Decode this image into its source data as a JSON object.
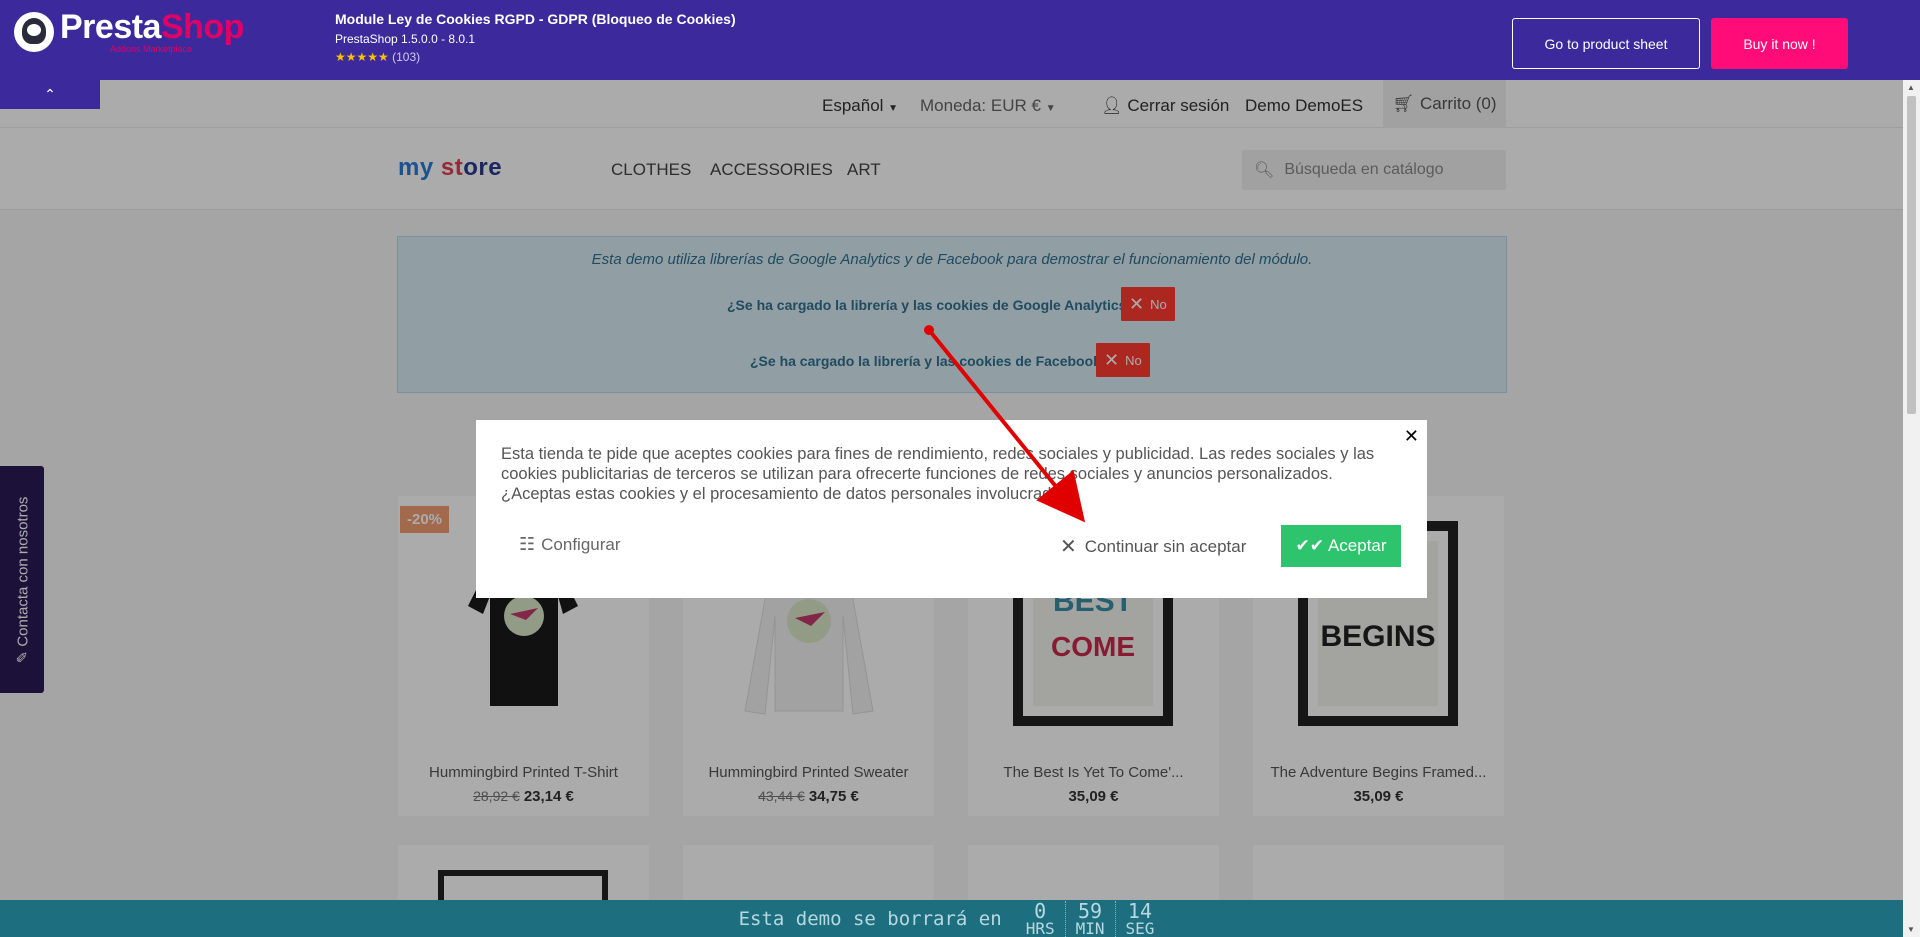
{
  "addons_bar": {
    "logo_text": "PrestaShop",
    "logo_sub": "Addons Marketplace",
    "product_title": "Module Ley de Cookies RGPD - GDPR (Bloqueo de Cookies)",
    "product_version": "PrestaShop 1.5.0.0 - 8.0.1",
    "rating_stars": "★★★★★",
    "rating_count": "(103)",
    "btn_sheet": "Go to product sheet",
    "btn_buy": "Buy it now !",
    "collapse_icon": "⌃"
  },
  "store_nav": {
    "language": "Español",
    "currency": "Moneda: EUR €",
    "logout": "Cerrar sesión",
    "user": "Demo DemoES",
    "cart": "Carrito (0)"
  },
  "store": {
    "logo": [
      "my",
      " st",
      "ore"
    ],
    "menu": [
      "CLOTHES",
      "ACCESSORIES",
      "ART"
    ],
    "search_placeholder": "Búsqueda en catálogo"
  },
  "demo_info": {
    "line1": "Esta demo utiliza librerías de Google Analytics y de Facebook para demostrar el funcionamiento del módulo.",
    "q_google": "¿Se ha cargado la librería y las cookies de Google Analytics?",
    "q_facebook": "¿Se ha cargado la librería y las cookies de Facebook?",
    "no_label": "No"
  },
  "products": [
    {
      "name": "Hummingbird Printed T-Shirt",
      "old_price": "28,92 €",
      "price": "23,14 €",
      "discount": "-20%"
    },
    {
      "name": "Hummingbird Printed Sweater",
      "old_price": "43,44 €",
      "price": "34,75 €"
    },
    {
      "name": "The Best Is Yet To Come'...",
      "price": "35,09 €"
    },
    {
      "name": "The Adventure Begins Framed...",
      "price": "35,09 €"
    }
  ],
  "contact_tab": "Contacta con nosotros",
  "cookie_modal": {
    "text": "Esta tienda te pide que aceptes cookies para fines de rendimiento, redes sociales y publicidad. Las redes sociales y las cookies publicitarias de terceros se utilizan para ofrecerte funciones de redes sociales y anuncios personalizados. ¿Aceptas estas cookies y el procesamiento de datos personales involucrados?",
    "configure": "Configurar",
    "reject": "Continuar sin aceptar",
    "accept": "Aceptar"
  },
  "countdown": {
    "label": "Esta demo se borrará en",
    "hours": "0",
    "hours_unit": "HRS",
    "minutes": "59",
    "minutes_unit": "MIN",
    "seconds": "14",
    "seconds_unit": "SEG"
  },
  "colors": {
    "addons_purple": "#3c2a9c",
    "buy_pink": "#ff0c78",
    "accept_green": "#2ec36d",
    "no_red": "#ff3b30",
    "annotation_arrow": "#e00000"
  }
}
